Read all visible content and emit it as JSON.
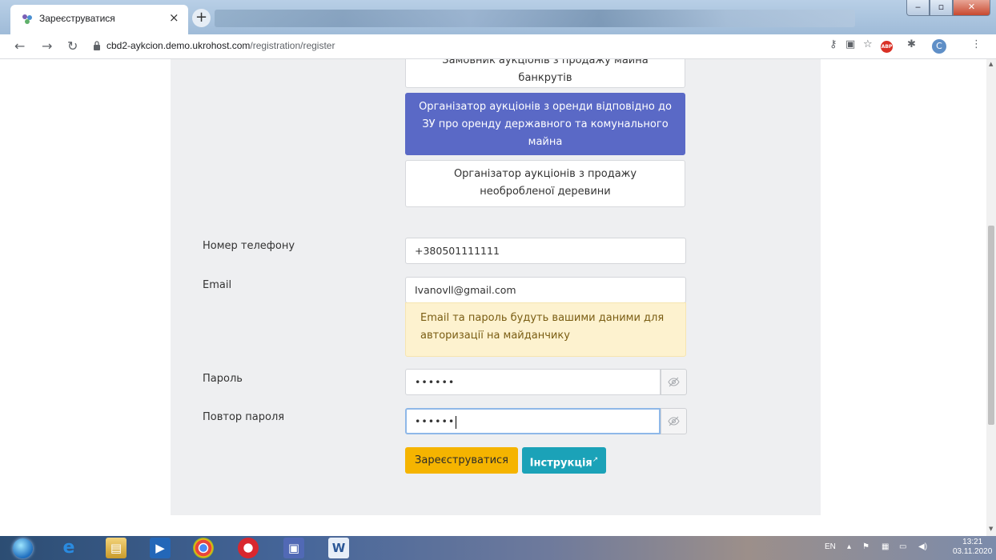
{
  "browser": {
    "tab_title": "Зареєструватися",
    "tab_close": "×",
    "new_tab": "+",
    "url_host": "cbd2-aykcion.demo.ukrohost.com",
    "url_path": "/registration/register",
    "avatar_letter": "C",
    "abp_label": "ABP"
  },
  "roles": [
    {
      "label": "Замовник аукціонів з продажу майна банкрутів",
      "active": false
    },
    {
      "label": "Організатор аукціонів з оренди відповідно до ЗУ про оренду державного та комунального майна",
      "active": true
    },
    {
      "label": "Організатор аукціонів з продажу необробленої деревини",
      "active": false
    }
  ],
  "form": {
    "phone_label": "Номер телефону",
    "phone_value": "+380501111111",
    "email_label": "Email",
    "email_value": "Ivanovll@gmail.com",
    "email_notice": "Email та пароль будуть вашими даними для авторизації на майданчику",
    "password_label": "Пароль",
    "password_value": "••••••",
    "password_repeat_label": "Повтор пароля",
    "password_repeat_value": "••••••",
    "register_button": "Зареєструватися",
    "instructions_button": "Інструкція"
  },
  "taskbar": {
    "language": "EN",
    "time": "13:21",
    "date": "03.11.2020"
  },
  "colors": {
    "active_role": "#5a69c6",
    "register_button": "#f5b400",
    "instructions_button": "#1ba2b8",
    "notice_bg": "#fdf2cf"
  }
}
